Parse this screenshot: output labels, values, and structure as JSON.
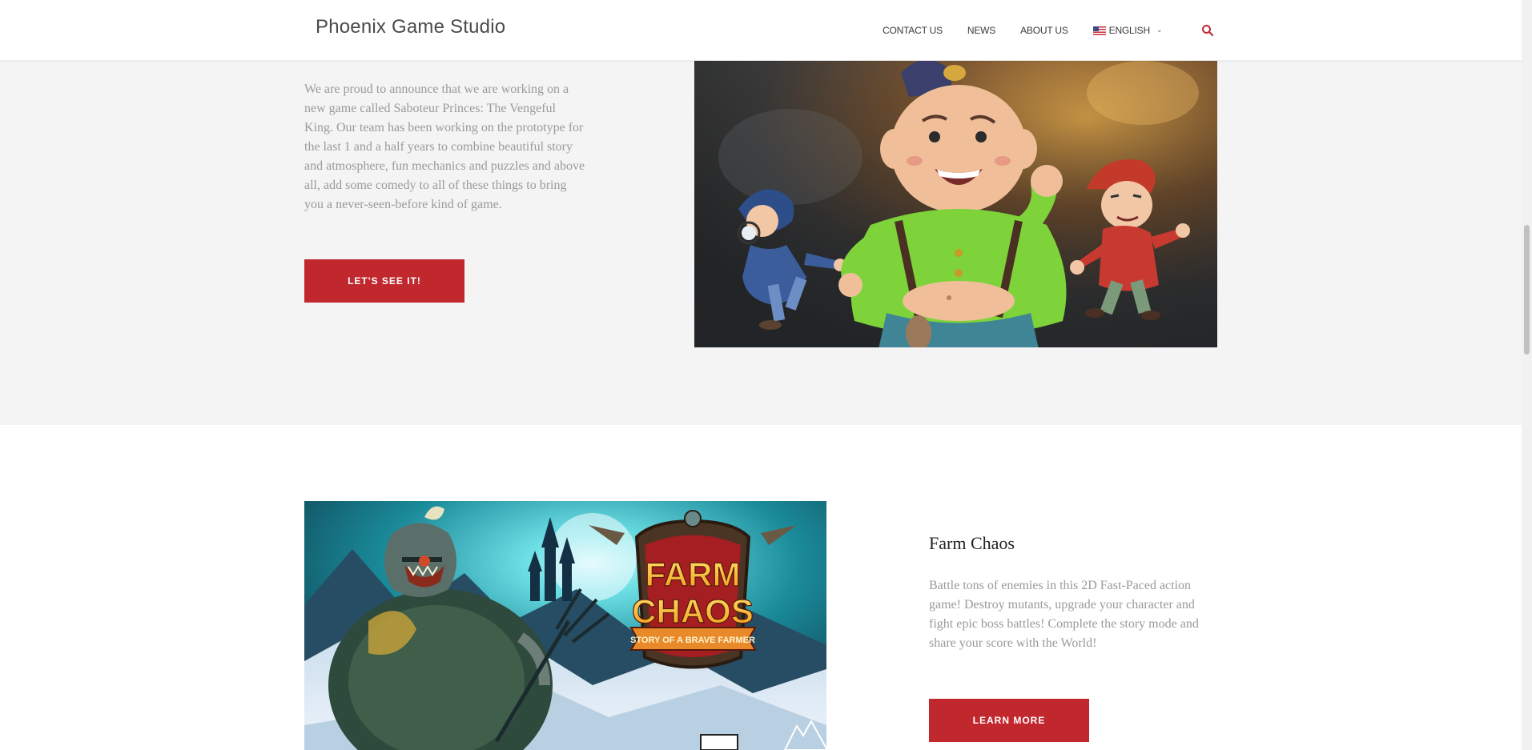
{
  "header": {
    "logo": "Phoenix Game Studio",
    "nav": {
      "contact": "CONTACT US",
      "news": "NEWS",
      "about": "ABOUT US",
      "language": "ENGLISH"
    },
    "icons": {
      "flag": "us-flag-icon",
      "chevron": "chevron-down-icon",
      "search": "search-icon"
    }
  },
  "section1": {
    "description": "We are proud to announce that we are working on a new game called Saboteur Princes: The Vengeful King. Our team has been working on the prototype for the last 1 and a half years to combine beautiful story and atmosphere, fun mechanics and puzzles and above all, add some comedy to all of these things to bring you a never-seen-before kind of game.",
    "button": "LET'S SEE IT!"
  },
  "section2": {
    "title": "Farm Chaos",
    "description": "Battle tons of enemies in this 2D Fast-Paced action game! Destroy mutants, upgrade your character and fight epic boss battles! Complete the story mode and share your score with the World!",
    "button": "LEARN MORE",
    "logo_line1": "FARM",
    "logo_line2": "CHAOS",
    "logo_ribbon": "STORY OF A BRAVE FARMER"
  },
  "colors": {
    "accent": "#c0282e",
    "body_text": "#9a9a9a",
    "section_bg": "#f4f4f5"
  }
}
